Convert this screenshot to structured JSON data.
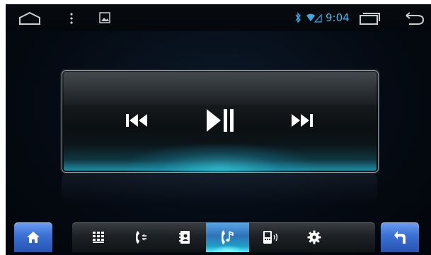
{
  "status_bar": {
    "time": "9:04",
    "icons": [
      "home-outline-icon",
      "overflow-menu-icon",
      "gallery-icon",
      "bluetooth-icon",
      "wifi-signal-icon",
      "recent-apps-icon",
      "back-arrow-icon"
    ]
  },
  "player": {
    "controls": [
      "previous-track-icon",
      "play-pause-icon",
      "next-track-icon"
    ]
  },
  "dock": {
    "left": "home-icon",
    "items": [
      "keypad-icon",
      "call-log-icon",
      "contacts-icon",
      "music-bluetooth-icon",
      "phone-sync-icon",
      "settings-gear-icon"
    ],
    "active_index": 3,
    "right": "return-icon"
  },
  "colors": {
    "time_text": "#4fb8e6",
    "accent_blue": "#3d73d8",
    "active_glow": "#56f0ff"
  }
}
